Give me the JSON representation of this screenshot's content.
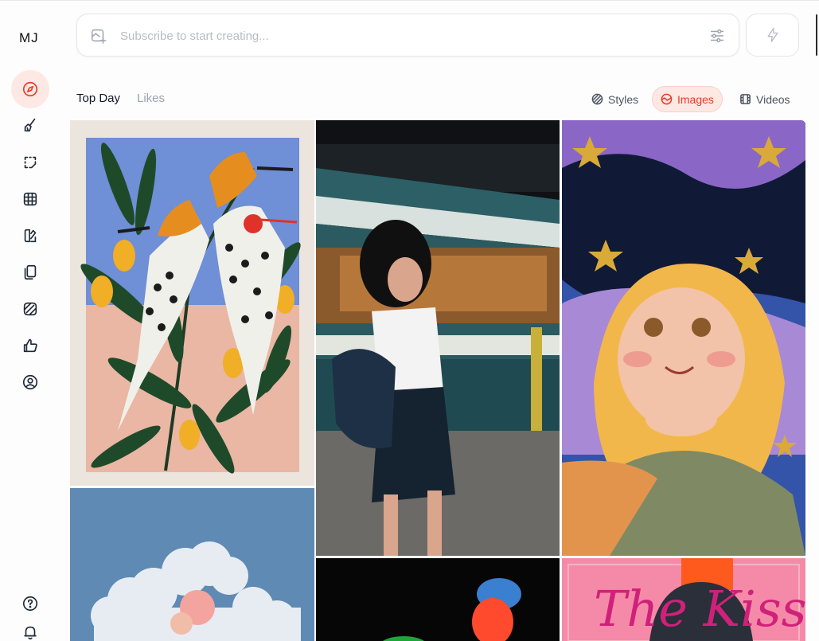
{
  "brand": {
    "logo_text": "MJ"
  },
  "sidebar": {
    "icons": [
      "explore-icon",
      "create-icon",
      "edit-icon",
      "organize-icon",
      "personalize-icon",
      "archive-icon",
      "rooms-icon",
      "likes-icon",
      "profile-icon"
    ],
    "bottom_icons": [
      "help-icon",
      "notifications-icon"
    ]
  },
  "prompt": {
    "placeholder": "Subscribe to start creating...",
    "value": ""
  },
  "tabs": [
    {
      "label": "Top Day",
      "active": true
    },
    {
      "label": "Likes",
      "active": false
    }
  ],
  "filters": [
    {
      "label": "Styles",
      "active": false,
      "icon": "styles-icon"
    },
    {
      "label": "Images",
      "active": true,
      "icon": "images-icon"
    },
    {
      "label": "Videos",
      "active": false,
      "icon": "videos-icon"
    }
  ],
  "colors": {
    "accent": "#ea3a23",
    "accent_bg": "#fde8e4",
    "muted_text": "#9ca3af"
  },
  "gallery": {
    "images": [
      "hoopoe-birds-illustration",
      "girl-at-train-station-photo",
      "girl-under-starry-sky-painting",
      "clouds-coral-photo",
      "neon-blur-abstract",
      "the-kiss-poster"
    ],
    "poster_text": "The Kiss"
  }
}
